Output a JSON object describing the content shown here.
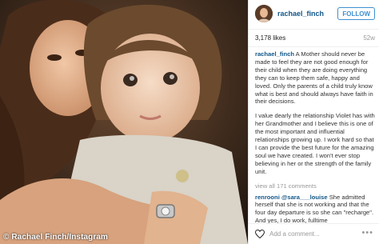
{
  "photo": {
    "credit": "© Rachael Finch/Instagram"
  },
  "header": {
    "username": "rachael_finch",
    "follow_label": "FOLLOW"
  },
  "stats": {
    "likes": "3,178 likes",
    "time_ago": "52w"
  },
  "caption": {
    "username": "rachael_finch",
    "text1": "A Mother should never be made to feel they are not good enough for their child when they are doing everything they can to keep them safe, happy and loved. Only the parents of a child truly know what is best and should always have faith in their decisions.",
    "text2": "I value dearly the relationship Violet has with her Grandmother and I believe this is one of the most important and influential relationships growing up. I work hard so that I can provide the best future for the amazing soul we have created. I won't ever stop believing in her or the strength of the family unit."
  },
  "view_all": "view all 171 comments",
  "comments": [
    {
      "username": "renrooni",
      "mention": "@sara___louise",
      "text": "She admitted herself that she is not working and that the four day departure is so she can \"recharge\". And yes, I do work, fulltime"
    }
  ],
  "footer": {
    "add_comment": "Add a comment...",
    "more": "•••"
  },
  "colors": {
    "link": "#125688",
    "follow": "#3f8fcf",
    "heart": "#262626"
  }
}
